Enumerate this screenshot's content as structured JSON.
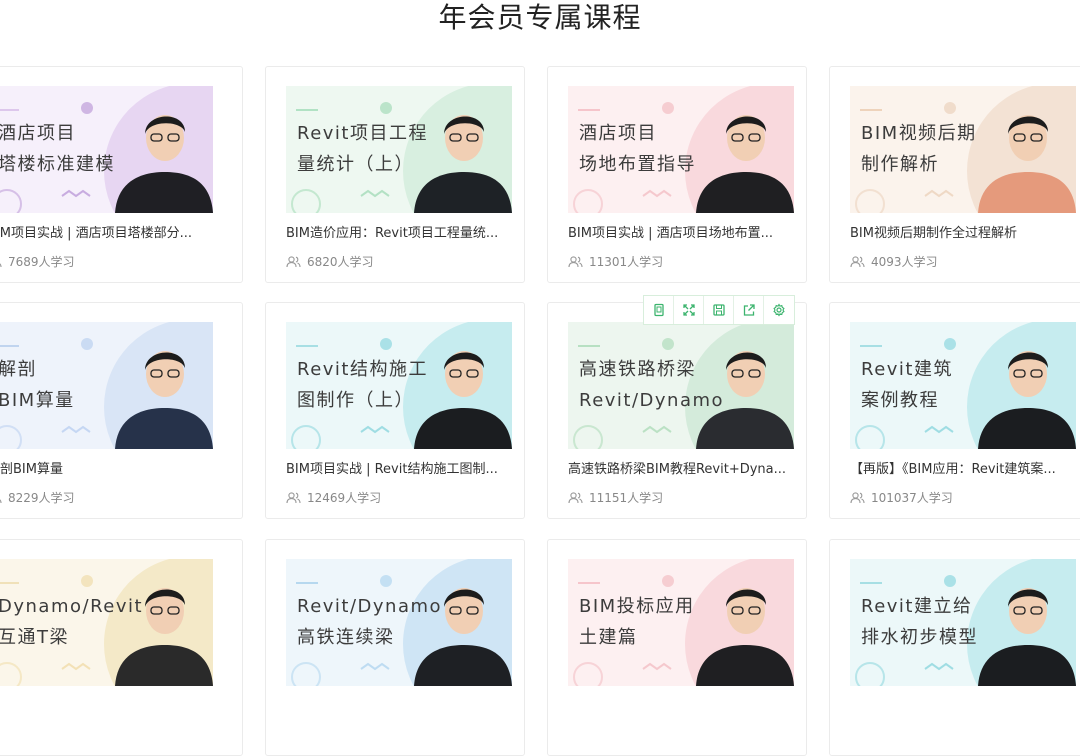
{
  "page": {
    "title": "年会员专属课程"
  },
  "colors": {
    "accent_green": "#3cb46e",
    "muted_text": "#888888"
  },
  "toolbar": {
    "buttons": [
      {
        "name": "copy-icon"
      },
      {
        "name": "expand-icon"
      },
      {
        "name": "save-icon"
      },
      {
        "name": "share-icon"
      },
      {
        "name": "gear-icon"
      }
    ]
  },
  "courses": [
    {
      "thumb_lines": [
        "酒店项目",
        "塔楼标准建模"
      ],
      "title": "BIM项目实战 | 酒店项目塔楼部分...",
      "learners": "7689人学习",
      "theme": "lavender"
    },
    {
      "thumb_lines": [
        "Revit项目工程",
        "量统计（上）"
      ],
      "title": "BIM造价应用：Revit项目工程量统...",
      "learners": "6820人学习",
      "theme": "mint"
    },
    {
      "thumb_lines": [
        "酒店项目",
        "场地布置指导"
      ],
      "title": "BIM项目实战 | 酒店项目场地布置...",
      "learners": "11301人学习",
      "theme": "pink"
    },
    {
      "thumb_lines": [
        "BIM视频后期",
        "制作解析"
      ],
      "title": "BIM视频后期制作全过程解析",
      "learners": "4093人学习",
      "theme": "peach"
    },
    {
      "thumb_lines": [
        "解剖",
        "BIM算量"
      ],
      "title": "解剖BIM算量",
      "learners": "8229人学习",
      "theme": "blue"
    },
    {
      "thumb_lines": [
        "Revit结构施工",
        "图制作（上）"
      ],
      "title": "BIM项目实战 | Revit结构施工图制...",
      "learners": "12469人学习",
      "theme": "cyan"
    },
    {
      "thumb_lines": [
        "高速铁路桥梁",
        "Revit/Dynamo"
      ],
      "title": "高速铁路桥梁BIM教程Revit+Dyna...",
      "learners": "11151人学习",
      "theme": "green"
    },
    {
      "thumb_lines": [
        "Revit建筑",
        "案例教程"
      ],
      "title": "【再版】《BIM应用：Revit建筑案...",
      "learners": "101037人学习",
      "theme": "cyan"
    },
    {
      "thumb_lines": [
        "Dynamo/Revit",
        "互通T梁"
      ],
      "title": "",
      "learners": "",
      "theme": "cream"
    },
    {
      "thumb_lines": [
        "Revit/Dynamo",
        "高铁连续梁"
      ],
      "title": "",
      "learners": "",
      "theme": "skyblue"
    },
    {
      "thumb_lines": [
        "BIM投标应用",
        "土建篇"
      ],
      "title": "",
      "learners": "",
      "theme": "pink"
    },
    {
      "thumb_lines": [
        "Revit建立给",
        "排水初步模型"
      ],
      "title": "",
      "learners": "",
      "theme": "cyan"
    }
  ]
}
